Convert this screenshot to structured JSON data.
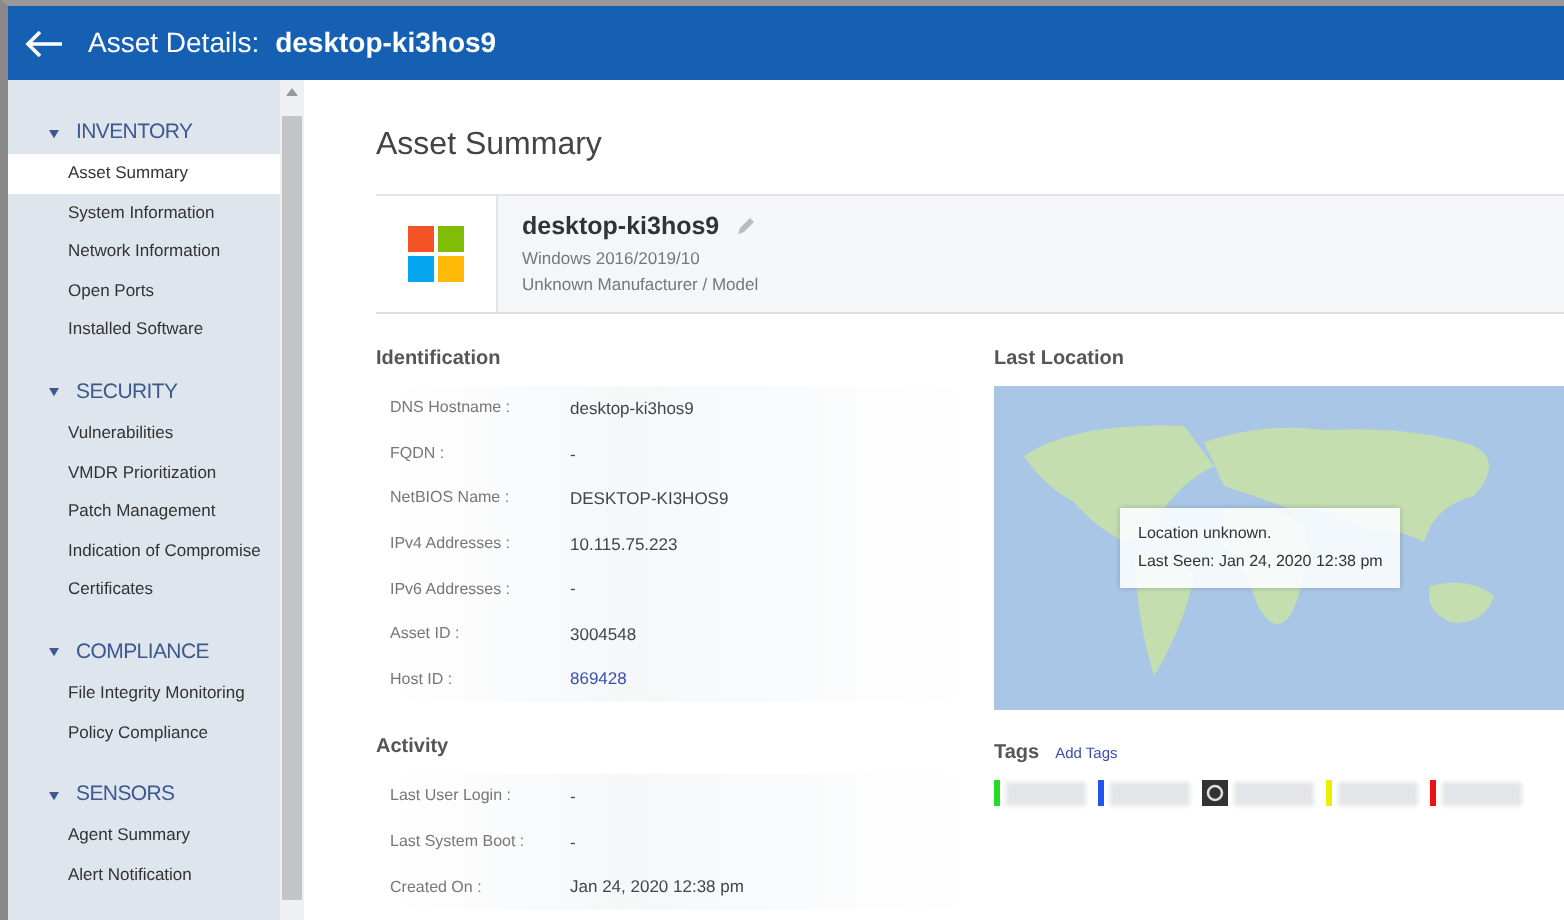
{
  "header": {
    "label": "Asset Details:",
    "value": "desktop-ki3hos9"
  },
  "sidebar": {
    "sections": [
      {
        "title": "INVENTORY",
        "expanded": true,
        "items": [
          {
            "label": "Asset Summary",
            "selected": true
          },
          {
            "label": "System Information",
            "selected": false
          },
          {
            "label": "Network Information",
            "selected": false
          },
          {
            "label": "Open Ports",
            "selected": false
          },
          {
            "label": "Installed Software",
            "selected": false
          }
        ]
      },
      {
        "title": "SECURITY",
        "expanded": true,
        "items": [
          {
            "label": "Vulnerabilities",
            "selected": false
          },
          {
            "label": "VMDR Prioritization",
            "selected": false
          },
          {
            "label": "Patch Management",
            "selected": false
          },
          {
            "label": "Indication of Compromise",
            "selected": false
          },
          {
            "label": "Certificates",
            "selected": false
          }
        ]
      },
      {
        "title": "COMPLIANCE",
        "expanded": true,
        "items": [
          {
            "label": "File Integrity Monitoring",
            "selected": false
          },
          {
            "label": "Policy Compliance",
            "selected": false
          }
        ]
      },
      {
        "title": "SENSORS",
        "expanded": true,
        "items": [
          {
            "label": "Agent Summary",
            "selected": false
          },
          {
            "label": "Alert Notification",
            "selected": false
          }
        ]
      }
    ]
  },
  "page_title": "Asset Summary",
  "asset": {
    "name": "desktop-ki3hos9",
    "os": "Windows 2016/2019/10",
    "manufacturer": "Unknown Manufacturer / Model"
  },
  "identification": {
    "title": "Identification",
    "rows": [
      {
        "label": "DNS Hostname :",
        "value": "desktop-ki3hos9",
        "kind": "text"
      },
      {
        "label": "FQDN :",
        "value": "-",
        "kind": "text"
      },
      {
        "label": "NetBIOS Name :",
        "value": "DESKTOP-KI3HOS9",
        "kind": "text"
      },
      {
        "label": "IPv4 Addresses :",
        "value": "10.115.75.223",
        "kind": "text"
      },
      {
        "label": "IPv6 Addresses :",
        "value": "-",
        "kind": "text"
      },
      {
        "label": "Asset ID :",
        "value": "3004548",
        "kind": "text"
      },
      {
        "label": "Host ID :",
        "value": "869428",
        "kind": "link"
      }
    ]
  },
  "activity": {
    "title": "Activity",
    "rows": [
      {
        "label": "Last User Login :",
        "value": "-",
        "kind": "text"
      },
      {
        "label": "Last System Boot :",
        "value": "-",
        "kind": "text"
      },
      {
        "label": "Created On :",
        "value": "Jan 24, 2020 12:38 pm",
        "kind": "text"
      }
    ]
  },
  "last_location": {
    "title": "Last Location",
    "tooltip": [
      "Location unknown.",
      "Last Seen: Jan 24, 2020 12:38 pm"
    ]
  },
  "tags": {
    "title": "Tags",
    "add_link": "Add Tags",
    "items": [
      {
        "kind": "bar",
        "color": "#22dd22"
      },
      {
        "kind": "bar",
        "color": "#2255ee"
      },
      {
        "kind": "icon"
      },
      {
        "kind": "bar",
        "color": "#eeee00"
      },
      {
        "kind": "bar",
        "color": "#ee1111"
      }
    ]
  }
}
